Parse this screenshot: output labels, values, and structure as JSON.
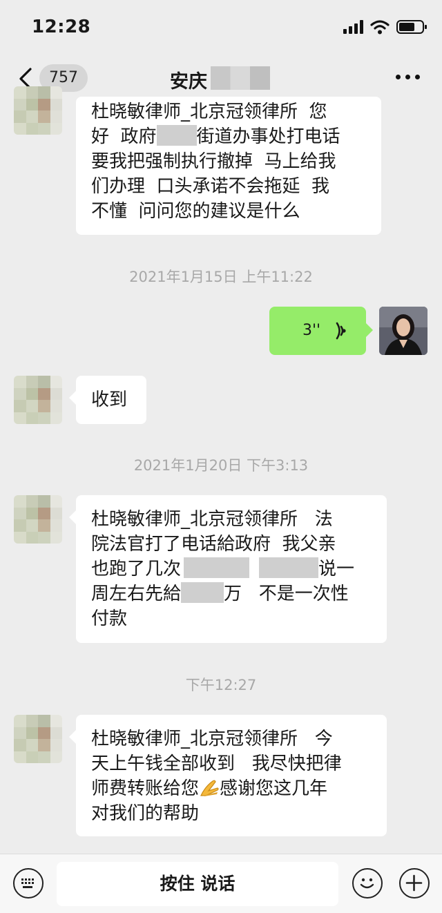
{
  "status_bar": {
    "time": "12:28"
  },
  "nav": {
    "unread_count": "757",
    "title": "安庆"
  },
  "messages": [
    {
      "lines": [
        "杜晓敏律师_北京冠领律所  您",
        "好  政府",
        "街道办事处打电话",
        "要我把强制执行撤掉  马上给我",
        "们办理  口头承诺不会拖延  我",
        "不懂  问问您的建议是什么"
      ]
    },
    {
      "lines": [
        "收到"
      ]
    },
    {
      "lines": [
        "杜晓敏律师_北京冠领律所   法",
        "院法官打了电话給政府  我父亲",
        "也跑了几次",
        "说一",
        "周左右先給",
        "万   不是一次性",
        "付款"
      ]
    },
    {
      "lines": [
        "杜晓敏律师_北京冠领律所   今",
        "天上午钱全部收到   我尽快把律",
        "师费转账给您",
        "感谢您这几年",
        "对我们的帮助"
      ]
    }
  ],
  "timestamps": [
    "2021年1月15日 上午11:22",
    "2021年1月20日 下午3:13",
    "下午12:27"
  ],
  "voice_message": {
    "duration": "3''"
  },
  "input_bar": {
    "hold_to_talk": "按住 说话"
  },
  "colors": {
    "background": "#ededed",
    "bubble_received": "#ffffff",
    "bubble_sent": "#95ec69",
    "timestamp": "#a8a8a8"
  }
}
